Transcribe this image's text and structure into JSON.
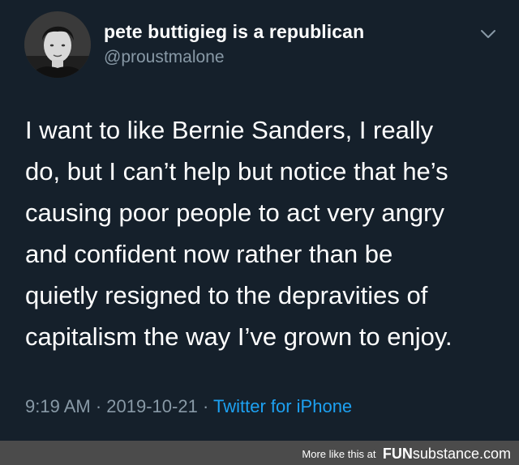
{
  "colors": {
    "background": "#15202b",
    "text": "#ffffff",
    "secondary_text": "#8899a6",
    "link": "#1da1f2",
    "footer_bar": "#4b4b4b"
  },
  "tweet": {
    "author": {
      "display_name": "pete buttigieg is a republican",
      "handle": "@proustmalone",
      "avatar": "profile-photo"
    },
    "menu_icon": "chevron-down-icon",
    "text_lines": [
      "I want to like Bernie Sanders, I really",
      "do, but I can’t help but notice that he’s",
      "causing poor people to act very angry",
      "and confident now rather than be",
      "quietly resigned to the depravities of",
      "capitalism the way I’ve grown to enjoy."
    ],
    "time": "9:19 AM",
    "separator": " · ",
    "date": "2019-10-21",
    "source": "Twitter for iPhone"
  },
  "watermark": {
    "more_text": "More like this at",
    "brand_part1": "FUN",
    "brand_part2": "substance",
    "brand_part3": ".com"
  }
}
